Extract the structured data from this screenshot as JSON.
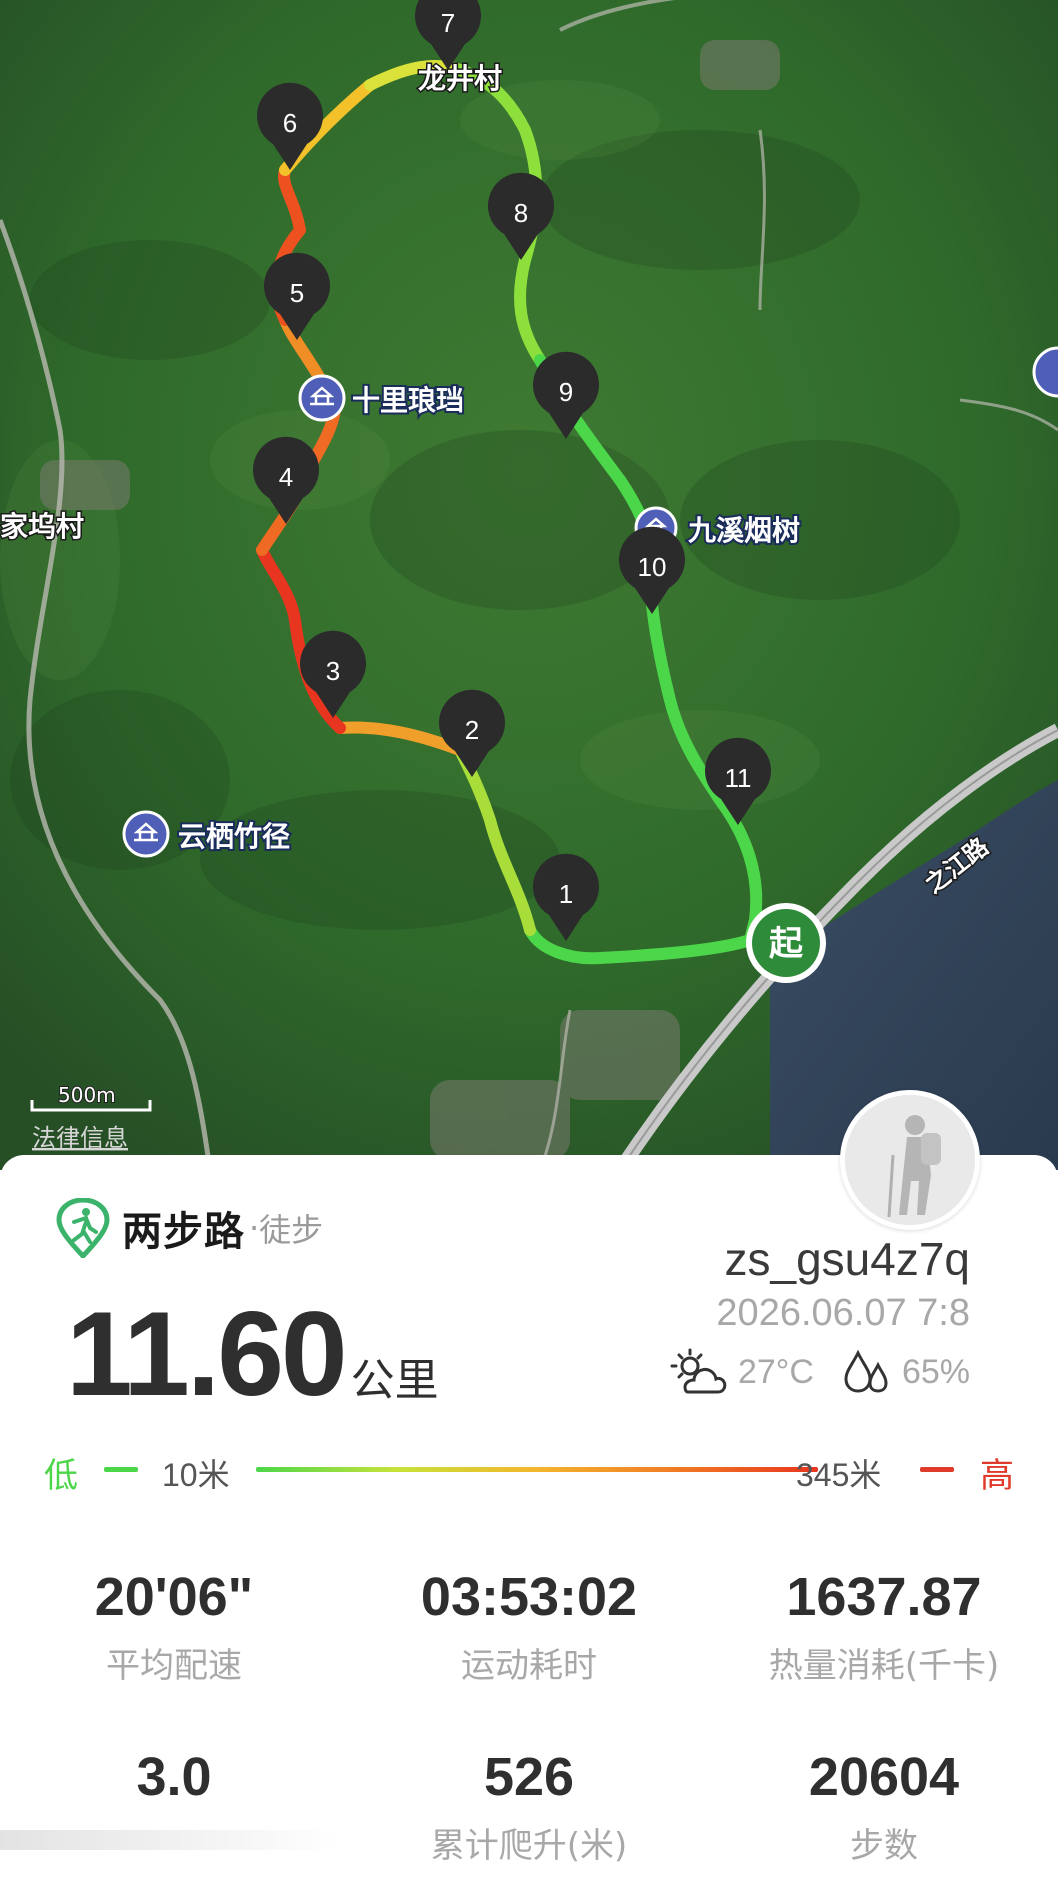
{
  "map": {
    "places": {
      "longjing": "龙井村",
      "jiawu": "家坞村",
      "zhijiang": "之江路"
    },
    "pois": {
      "shili": "十里琅珰",
      "jiuxi": "九溪烟树",
      "yunqi": "云栖竹径"
    },
    "markers": [
      "1",
      "2",
      "3",
      "4",
      "5",
      "6",
      "7",
      "8",
      "9",
      "10",
      "11"
    ],
    "start_label": "起",
    "scale_label": "500m",
    "legal_label": "法律信息",
    "colors": {
      "low": "#4cd64a",
      "high": "#e8351f",
      "start": "#2e8b3a",
      "brand": "#3bb36b"
    }
  },
  "card": {
    "brand_name": "两步路",
    "brand_sep": "·",
    "sport": "徒步",
    "distance_value": "11.60",
    "distance_unit": "公里",
    "username": "zs_gsu4z7q",
    "datetime": "2026.06.07 7:8",
    "temperature": "27°C",
    "humidity": "65%",
    "weather_icon": "partly-cloudy-icon",
    "humidity_icon": "water-drops-icon",
    "legend": {
      "low_label": "低",
      "low_value": "10米",
      "high_value": "345米",
      "high_label": "高"
    },
    "stats": [
      {
        "value": "20'06\"",
        "label": "平均配速"
      },
      {
        "value": "03:53:02",
        "label": "运动耗时"
      },
      {
        "value": "1637.87",
        "label": "热量消耗(千卡)"
      },
      {
        "value": "3.0",
        "label": ""
      },
      {
        "value": "526",
        "label": "累计爬升(米)"
      },
      {
        "value": "20604",
        "label": "步数"
      }
    ]
  }
}
